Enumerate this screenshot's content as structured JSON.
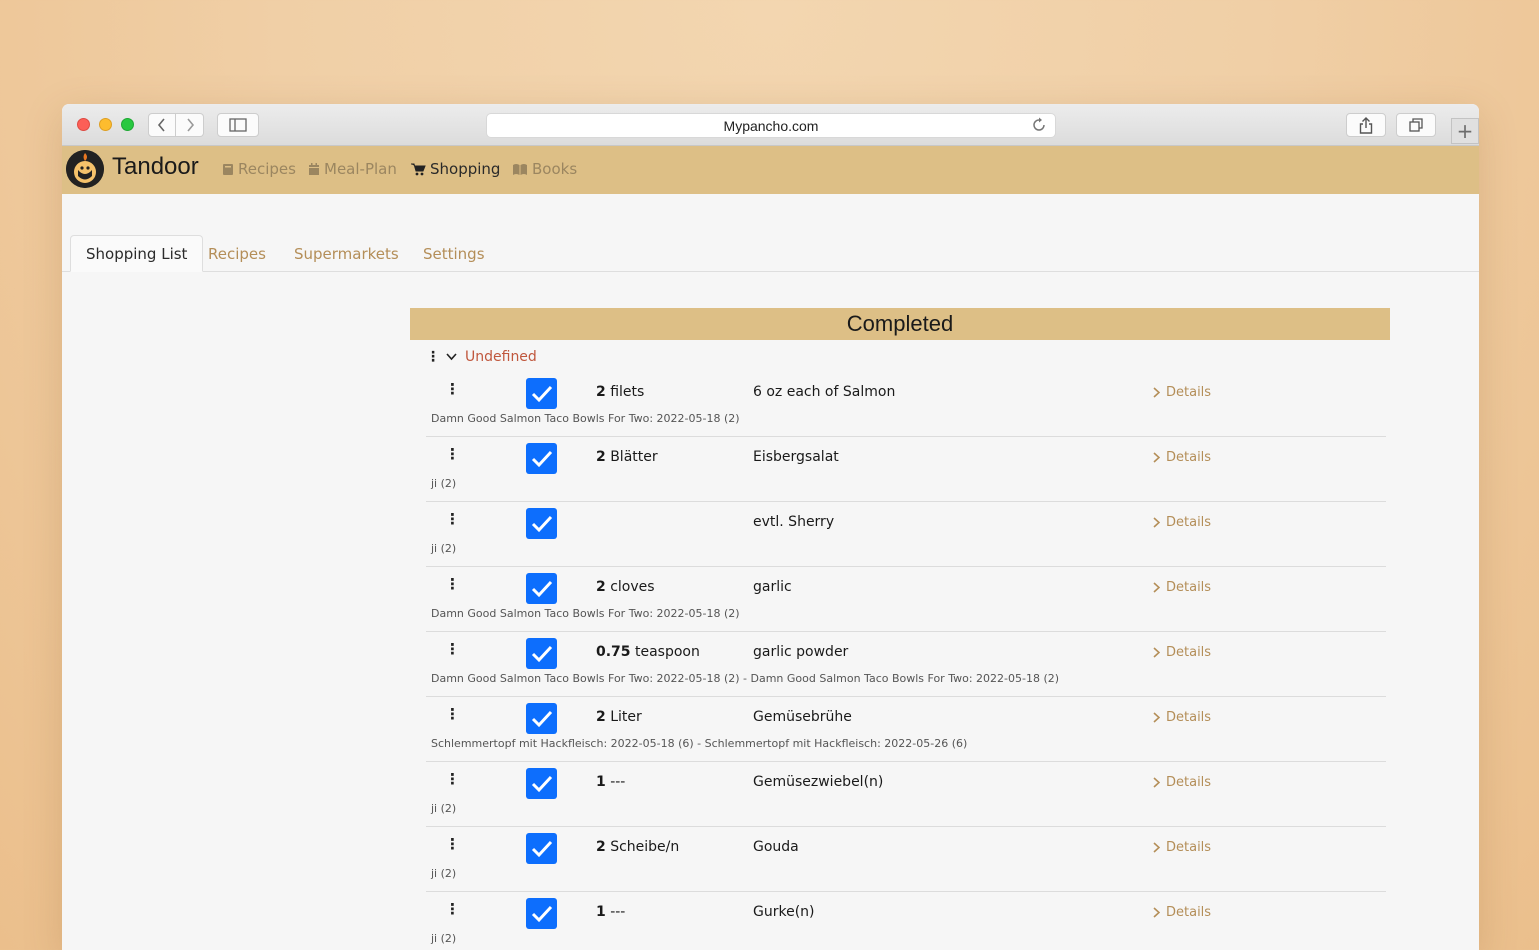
{
  "browser": {
    "url": "Mypancho.com",
    "back_icon": "chevron-left-icon",
    "forward_icon": "chevron-right-icon"
  },
  "app": {
    "brand": "Tandoor",
    "nav": [
      {
        "label": "Recipes",
        "icon": "book-icon",
        "active": false
      },
      {
        "label": "Meal-Plan",
        "icon": "calendar-icon",
        "active": false
      },
      {
        "label": "Shopping",
        "icon": "cart-icon",
        "active": true
      },
      {
        "label": "Books",
        "icon": "books-icon",
        "active": false
      }
    ],
    "colors": {
      "navbar": "#ddbf86",
      "accent": "#b48e58",
      "category": "#c0573d",
      "checkbox": "#0d6efd"
    }
  },
  "tabs": [
    {
      "label": "Shopping List",
      "active": true
    },
    {
      "label": "Recipes",
      "active": false
    },
    {
      "label": "Supermarkets",
      "active": false
    },
    {
      "label": "Settings",
      "active": false
    }
  ],
  "list": {
    "section_title": "Completed",
    "category": "Undefined",
    "details_label": "Details",
    "items": [
      {
        "qty": "2",
        "unit": "filets",
        "food": "6 oz each of Salmon",
        "note": "Damn Good Salmon Taco Bowls For Two: 2022-05-18 (2)",
        "checked": true
      },
      {
        "qty": "2",
        "unit": "Blätter",
        "food": "Eisbergsalat",
        "note": "ji (2)",
        "checked": true
      },
      {
        "qty": "",
        "unit": "",
        "food": "evtl. Sherry",
        "note": "ji (2)",
        "checked": true
      },
      {
        "qty": "2",
        "unit": "cloves",
        "food": "garlic",
        "note": "Damn Good Salmon Taco Bowls For Two: 2022-05-18 (2)",
        "checked": true
      },
      {
        "qty": "0.75",
        "unit": "teaspoon",
        "food": "garlic powder",
        "note": "Damn Good Salmon Taco Bowls For Two: 2022-05-18 (2) - Damn Good Salmon Taco Bowls For Two: 2022-05-18 (2)",
        "checked": true
      },
      {
        "qty": "2",
        "unit": "Liter",
        "food": "Gemüsebrühe",
        "note": "Schlemmertopf mit Hackfleisch: 2022-05-18 (6) - Schlemmertopf mit Hackfleisch: 2022-05-26 (6)",
        "checked": true
      },
      {
        "qty": "1",
        "unit": "---",
        "food": "Gemüsezwiebel(n)",
        "note": "ji (2)",
        "checked": true
      },
      {
        "qty": "2",
        "unit": "Scheibe/n",
        "food": "Gouda",
        "note": "ji (2)",
        "checked": true
      },
      {
        "qty": "1",
        "unit": "---",
        "food": "Gurke(n)",
        "note": "ji (2)",
        "checked": true
      }
    ]
  }
}
